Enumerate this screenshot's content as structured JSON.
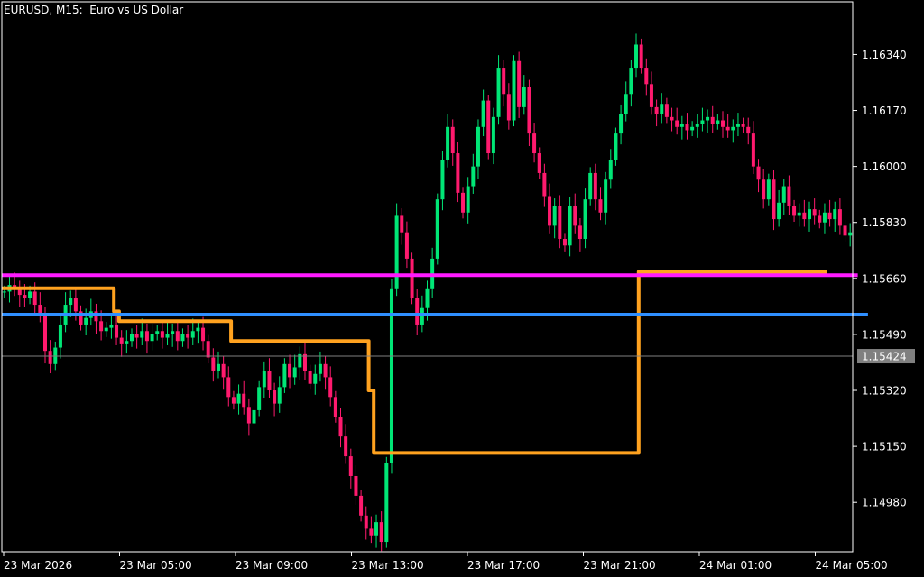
{
  "title": "EURUSD, M15:  Euro vs US Dollar",
  "current_price_label": "1.15424",
  "colors": {
    "background": "#000000",
    "axis": "#ffffff",
    "bull": "#00e676",
    "bear": "#ff1a6e",
    "orange": "#ffa21f",
    "blue": "#2f8fff",
    "magenta": "#ff1aff",
    "current_line": "#808080",
    "current_box": "#808080"
  },
  "chart_data": {
    "type": "candlestick",
    "symbol": "EURUSD",
    "timeframe": "M15",
    "ylim": [
      1.1483,
      1.165
    ],
    "y_ticks": [
      "1.16340",
      "1.16170",
      "1.16000",
      "1.15830",
      "1.15660",
      "1.15490",
      "1.15320",
      "1.15150",
      "1.14980"
    ],
    "x_ticks": [
      "23 Mar 2026",
      "23 Mar 05:00",
      "23 Mar 09:00",
      "23 Mar 13:00",
      "23 Mar 17:00",
      "23 Mar 21:00",
      "24 Mar 01:00",
      "24 Mar 05:00"
    ],
    "current_price": 1.15424,
    "closes": [
      1.1562,
      1.1564,
      1.1563,
      1.1561,
      1.156,
      1.1562,
      1.1558,
      1.1555,
      1.1544,
      1.154,
      1.1545,
      1.1552,
      1.1558,
      1.156,
      1.1556,
      1.1552,
      1.1554,
      1.1556,
      1.1553,
      1.155,
      1.1551,
      1.1552,
      1.1548,
      1.1546,
      1.1547,
      1.1549,
      1.1548,
      1.155,
      1.1547,
      1.1549,
      1.155,
      1.1548,
      1.1549,
      1.155,
      1.1547,
      1.1549,
      1.1548,
      1.155,
      1.1551,
      1.1547,
      1.1542,
      1.1538,
      1.154,
      1.1536,
      1.153,
      1.1528,
      1.1531,
      1.1527,
      1.1522,
      1.1526,
      1.1533,
      1.1538,
      1.1532,
      1.1528,
      1.1533,
      1.154,
      1.1536,
      1.1539,
      1.1543,
      1.1538,
      1.1534,
      1.1537,
      1.154,
      1.1536,
      1.153,
      1.1524,
      1.1518,
      1.1512,
      1.1506,
      1.15,
      1.1494,
      1.149,
      1.1488,
      1.1492,
      1.1486,
      1.151,
      1.1563,
      1.1585,
      1.158,
      1.1572,
      1.156,
      1.1552,
      1.1557,
      1.1563,
      1.1572,
      1.159,
      1.1602,
      1.1612,
      1.1604,
      1.1592,
      1.1586,
      1.1594,
      1.16,
      1.1612,
      1.162,
      1.1604,
      1.1615,
      1.163,
      1.1622,
      1.1614,
      1.1632,
      1.1618,
      1.1624,
      1.161,
      1.1604,
      1.1598,
      1.1591,
      1.1582,
      1.1588,
      1.1578,
      1.1576,
      1.1588,
      1.1582,
      1.1578,
      1.159,
      1.1598,
      1.159,
      1.1586,
      1.1596,
      1.1602,
      1.161,
      1.1616,
      1.1622,
      1.163,
      1.1637,
      1.163,
      1.1625,
      1.1618,
      1.1616,
      1.1619,
      1.1615,
      1.1614,
      1.1612,
      1.1613,
      1.1611,
      1.1612,
      1.1613,
      1.1614,
      1.1615,
      1.1613,
      1.1614,
      1.1612,
      1.1611,
      1.1612,
      1.1613,
      1.1612,
      1.161,
      1.16,
      1.1596,
      1.159,
      1.1596,
      1.1584,
      1.1589,
      1.1594,
      1.1588,
      1.1585,
      1.1586,
      1.1584,
      1.1587,
      1.1585,
      1.1583,
      1.1586,
      1.1584,
      1.1587,
      1.1582,
      1.1579,
      1.158
    ],
    "series": [
      {
        "name": "",
        "color": "orange",
        "values": [
          1.1563,
          1.1563,
          1.1563,
          1.1563,
          1.1563,
          1.1563,
          1.1563,
          1.1563,
          1.1563,
          1.1563,
          1.1563,
          1.1563,
          1.1563,
          1.1563,
          1.1563,
          1.1563,
          1.1563,
          1.1563,
          1.1563,
          1.1563,
          1.1563,
          1.1563,
          1.1556,
          1.1553,
          1.1553,
          1.1553,
          1.1553,
          1.1553,
          1.1553,
          1.1553,
          1.1553,
          1.1553,
          1.1553,
          1.1553,
          1.1553,
          1.1553,
          1.1553,
          1.1553,
          1.1553,
          1.1553,
          1.1553,
          1.1553,
          1.1553,
          1.1553,
          1.1553,
          1.1547,
          1.1547,
          1.1547,
          1.1547,
          1.1547,
          1.1547,
          1.1547,
          1.1547,
          1.1547,
          1.1547,
          1.1547,
          1.1547,
          1.1547,
          1.1547,
          1.1547,
          1.1547,
          1.1547,
          1.1547,
          1.1547,
          1.1547,
          1.1547,
          1.1547,
          1.1547,
          1.1547,
          1.1547,
          1.1547,
          1.1547,
          1.1532,
          1.1513,
          1.1513,
          1.1513,
          1.1513,
          1.1513,
          1.1513,
          1.1513,
          1.1513,
          1.1513,
          1.1513,
          1.1513,
          1.1513,
          1.1513,
          1.1513,
          1.1513,
          1.1513,
          1.1513,
          1.1513,
          1.1513,
          1.1513,
          1.1513,
          1.1513,
          1.1513,
          1.1513,
          1.1513,
          1.1513,
          1.1513,
          1.1513,
          1.1513,
          1.1513,
          1.1513,
          1.1513,
          1.1513,
          1.1513,
          1.1513,
          1.1513,
          1.1513,
          1.1513,
          1.1513,
          1.1513,
          1.1513,
          1.1513,
          1.1513,
          1.1513,
          1.1513,
          1.1513,
          1.1513,
          1.1513,
          1.1513,
          1.1513,
          1.1513,
          1.1513,
          1.1568,
          1.1568,
          1.1568,
          1.1568,
          1.1568,
          1.1568,
          1.1568,
          1.1568,
          1.1568,
          1.1568,
          1.1568,
          1.1568,
          1.1568,
          1.1568,
          1.1568,
          1.1568,
          1.1568,
          1.1568,
          1.1568,
          1.1568,
          1.1568,
          1.1568,
          1.1568,
          1.1568,
          1.1568,
          1.1568,
          1.1568,
          1.1568,
          1.1568,
          1.1568,
          1.1568,
          1.1568,
          1.1568,
          1.1568,
          1.1568,
          1.1568,
          1.1568
        ]
      },
      {
        "name": "",
        "color": "blue",
        "values": [
          1.1555,
          1.1555,
          1.1555,
          1.1555,
          1.1555,
          1.1555,
          1.1555,
          1.1555,
          1.1555,
          1.1555,
          1.1555,
          1.1555,
          1.1555,
          1.1555,
          1.1555,
          1.1555,
          1.1555,
          1.1555,
          1.1555,
          1.1555,
          1.1555,
          1.1555,
          1.1555,
          1.1555,
          1.1555,
          1.1555,
          1.1555,
          1.1555,
          1.1555,
          1.1555,
          1.1555,
          1.1555,
          1.1555,
          1.1555,
          1.1555,
          1.1555,
          1.1555,
          1.1555,
          1.1555,
          1.1555,
          1.1555,
          1.1555,
          1.1555,
          1.1555,
          1.1555,
          1.1555,
          1.1555,
          1.1555,
          1.1555,
          1.1555,
          1.1555,
          1.1555,
          1.1555,
          1.1555,
          1.1555,
          1.1555,
          1.1555,
          1.1555,
          1.1555,
          1.1555,
          1.1555,
          1.1555,
          1.1555,
          1.1555,
          1.1555,
          1.1555,
          1.1555,
          1.1555,
          1.1555,
          1.1555,
          1.1555,
          1.1555,
          1.1555,
          1.1555,
          1.1555,
          1.1555,
          1.1555,
          1.1555,
          1.1555,
          1.1555,
          1.1555,
          1.1555,
          1.1555,
          1.1555,
          1.1555,
          1.1555,
          1.1555,
          1.1555,
          1.1555,
          1.1555,
          1.1555,
          1.1555,
          1.1555,
          1.1555,
          1.1555,
          1.1555,
          1.1555,
          1.1555,
          1.1555,
          1.1555,
          1.1555,
          1.1555,
          1.1555,
          1.1555,
          1.1555,
          1.1555,
          1.1555,
          1.1555,
          1.1555,
          1.1555,
          1.1555,
          1.1555,
          1.1555,
          1.1555,
          1.1555,
          1.1555,
          1.1555,
          1.1555,
          1.1555,
          1.1555,
          1.1555,
          1.1555,
          1.1555,
          1.1555,
          1.1555,
          1.1555,
          1.1555,
          1.1555,
          1.1555,
          1.1555,
          1.1555,
          1.1555,
          1.1555,
          1.1555,
          1.1555,
          1.1555,
          1.1555,
          1.1555,
          1.1555,
          1.1555,
          1.1555,
          1.1555,
          1.1555,
          1.1555,
          1.1555,
          1.1555,
          1.1555,
          1.1555,
          1.1555,
          1.1555,
          1.1555,
          1.1555,
          1.1555,
          1.1555,
          1.1555,
          1.1555,
          1.1555,
          1.1555,
          1.1555,
          1.1555,
          1.1555,
          1.1555,
          1.1555,
          1.1555,
          1.1555,
          1.1555,
          1.1555,
          1.1555,
          1.1555,
          1.1555
        ]
      },
      {
        "name": "",
        "color": "magenta",
        "values": [
          1.1567,
          1.1567,
          1.1567,
          1.1567,
          1.1567,
          1.1567,
          1.1567,
          1.1567,
          1.1567,
          1.1567,
          1.1567,
          1.1567,
          1.1567,
          1.1567,
          1.1567,
          1.1567,
          1.1567,
          1.1567,
          1.1567,
          1.1567,
          1.1567,
          1.1567,
          1.1567,
          1.1567,
          1.1567,
          1.1567,
          1.1567,
          1.1567,
          1.1567,
          1.1567,
          1.1567,
          1.1567,
          1.1567,
          1.1567,
          1.1567,
          1.1567,
          1.1567,
          1.1567,
          1.1567,
          1.1567,
          1.1567,
          1.1567,
          1.1567,
          1.1567,
          1.1567,
          1.1567,
          1.1567,
          1.1567,
          1.1567,
          1.1567,
          1.1567,
          1.1567,
          1.1567,
          1.1567,
          1.1567,
          1.1567,
          1.1567,
          1.1567,
          1.1567,
          1.1567,
          1.1567,
          1.1567,
          1.1567,
          1.1567,
          1.1567,
          1.1567,
          1.1567,
          1.1567,
          1.1567,
          1.1567,
          1.1567,
          1.1567,
          1.1567,
          1.1567,
          1.1567,
          1.1567,
          1.1567,
          1.1567,
          1.1567,
          1.1567,
          1.1567,
          1.1567,
          1.1567,
          1.1567,
          1.1567,
          1.1567,
          1.1567,
          1.1567,
          1.1567,
          1.1567,
          1.1567,
          1.1567,
          1.1567,
          1.1567,
          1.1567,
          1.1567,
          1.1567,
          1.1567,
          1.1567,
          1.1567,
          1.1567,
          1.1567,
          1.1567,
          1.1567,
          1.1567,
          1.1567,
          1.1567,
          1.1567,
          1.1567,
          1.1567,
          1.1567,
          1.1567,
          1.1567,
          1.1567,
          1.1567,
          1.1567,
          1.1567,
          1.1567,
          1.1567,
          1.1567,
          1.1567,
          1.1567,
          1.1567,
          1.1567,
          1.1567,
          1.1567,
          1.1567,
          1.1567,
          1.1567,
          1.1567,
          1.1567,
          1.1567,
          1.1567,
          1.1567,
          1.1567,
          1.1567,
          1.1567,
          1.1567,
          1.1567,
          1.1567,
          1.1567,
          1.1567,
          1.1567,
          1.1567,
          1.1567,
          1.1567,
          1.1567,
          1.1567,
          1.1567,
          1.1567,
          1.1567,
          1.1567,
          1.1567,
          1.1567,
          1.1567,
          1.1567,
          1.1567,
          1.1567,
          1.1567,
          1.1567,
          1.1567,
          1.1567,
          1.1567,
          1.1567,
          1.1567,
          1.1567,
          1.1567,
          1.1567
        ]
      }
    ]
  }
}
